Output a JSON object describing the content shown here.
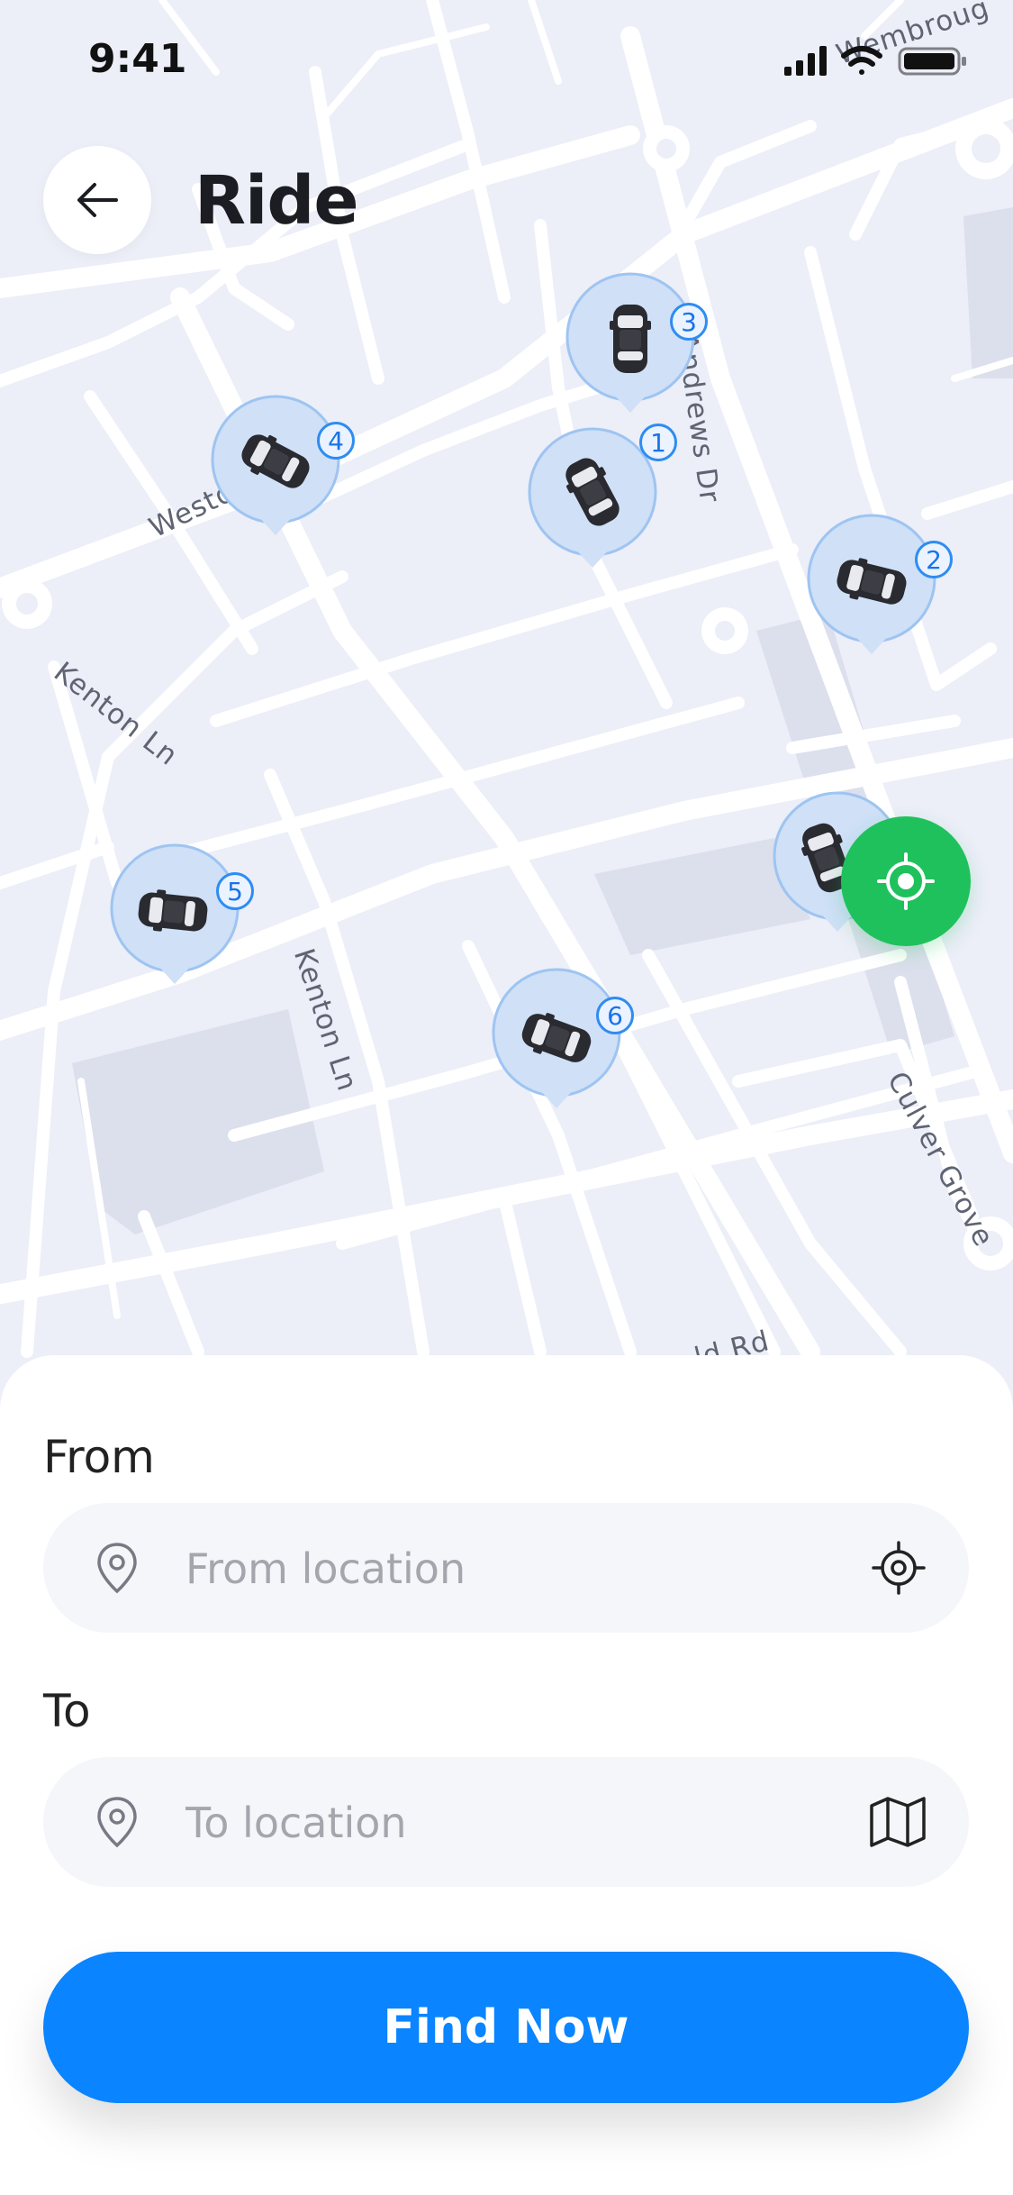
{
  "status_bar": {
    "time": "9:41"
  },
  "header": {
    "title": "Ride"
  },
  "map": {
    "street_labels": [
      "Wembroug",
      "Weston",
      "Kenton Ln",
      "Kenton Ln",
      "Andrews Dr",
      "Culver Grove",
      "ld Rd"
    ],
    "cars": [
      {
        "number": "1"
      },
      {
        "number": "2"
      },
      {
        "number": "3"
      },
      {
        "number": "4"
      },
      {
        "number": "5"
      },
      {
        "number": "6"
      }
    ],
    "accent_color": "#1fc15c"
  },
  "form": {
    "from": {
      "label": "From",
      "placeholder": "From location",
      "value": ""
    },
    "to": {
      "label": "To",
      "placeholder": "To location",
      "value": ""
    },
    "submit_label": "Find Now"
  },
  "colors": {
    "primary": "#0a84ff",
    "success": "#1fc15c",
    "badge": "#2f8cf0"
  }
}
